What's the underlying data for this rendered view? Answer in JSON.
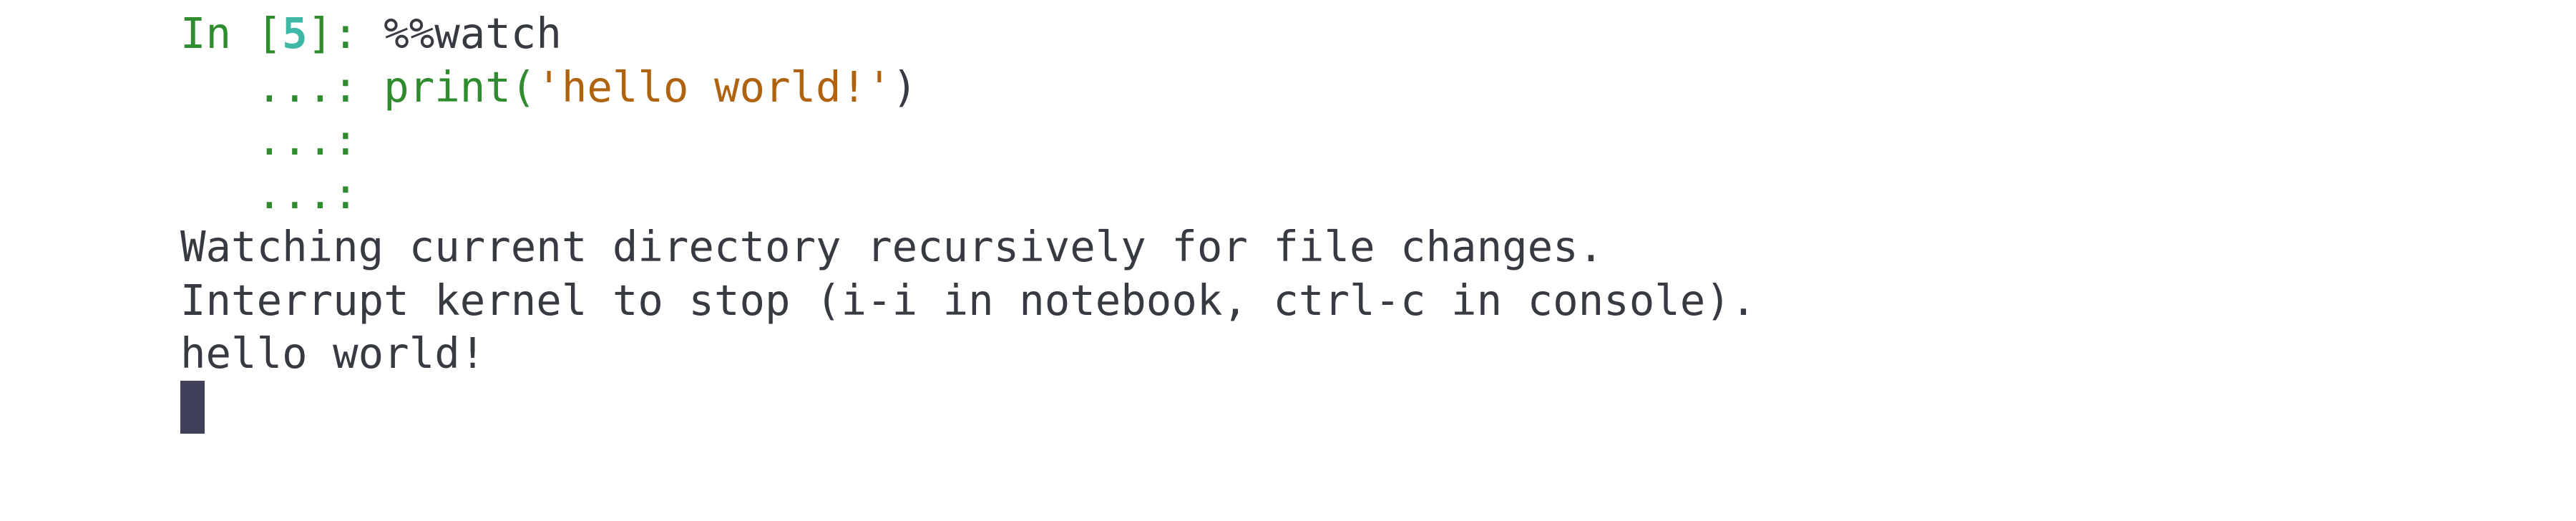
{
  "prompt": {
    "in_label": "In [",
    "cell_number": "5",
    "close_label": "]: ",
    "magic": "%%watch",
    "continuation": "   ...: ",
    "code_func": "print(",
    "code_string": "'hello world!'",
    "code_close": ")"
  },
  "output": {
    "line1": "Watching current directory recursively for file changes.",
    "line2": "Interrupt kernel to stop (i-i in notebook, ctrl-c in console).",
    "line3": "hello world!"
  },
  "colors": {
    "prompt": "#2e8b2e",
    "cell_number": "#3fb8a8",
    "string": "#b0630f",
    "text": "#383a42",
    "cursor": "#40405a"
  }
}
